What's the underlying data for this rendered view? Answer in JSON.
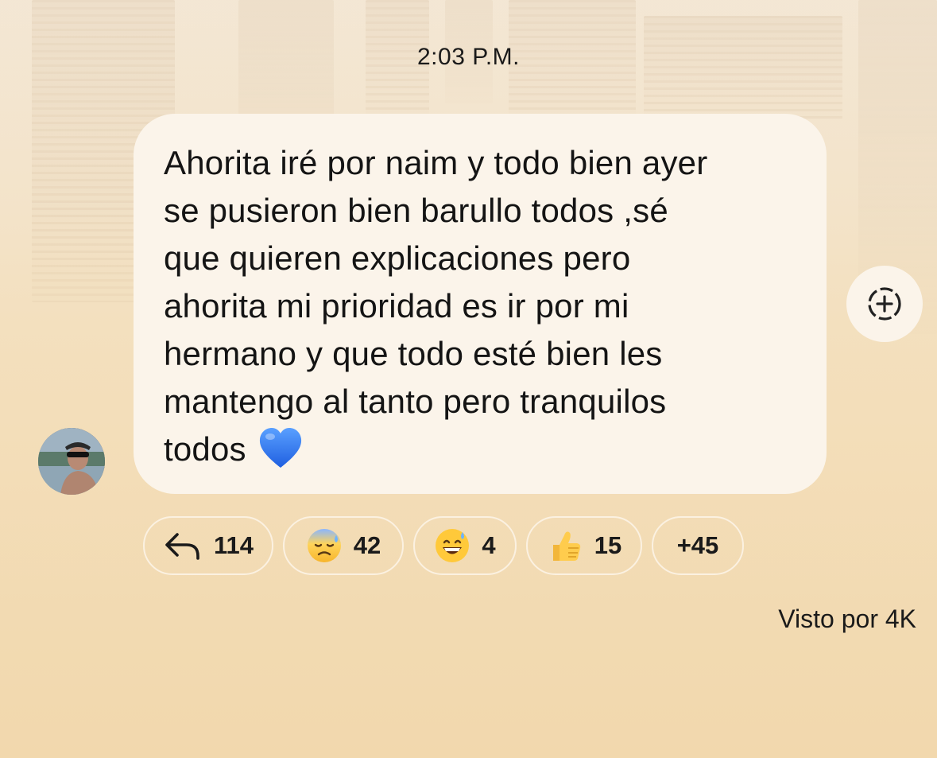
{
  "timestamp": "2:03 P.M.",
  "message": {
    "text": "Ahorita iré por naim y todo bien ayer\nse pusieron bien barullo todos ,sé\nque quieren explicaciones pero\nahorita mi prioridad es ir por mi\nhermano y que todo esté bien les\nmantengo al tanto pero tranquilos\ntodos",
    "emoji": "blue-heart"
  },
  "reactions": [
    {
      "icon": "reply-arrow-icon",
      "count": "114"
    },
    {
      "icon": "sad-sweat-face-emoji",
      "count": "42"
    },
    {
      "icon": "grinning-sweat-face-emoji",
      "count": "4"
    },
    {
      "icon": "thumbs-up-emoji",
      "count": "15"
    },
    {
      "label": "+45"
    }
  ],
  "seen_label": "Visto por 4K",
  "colors": {
    "bubble": "#fbf4ea",
    "background": "#f2d8ad",
    "heart": "#3b82f6"
  }
}
